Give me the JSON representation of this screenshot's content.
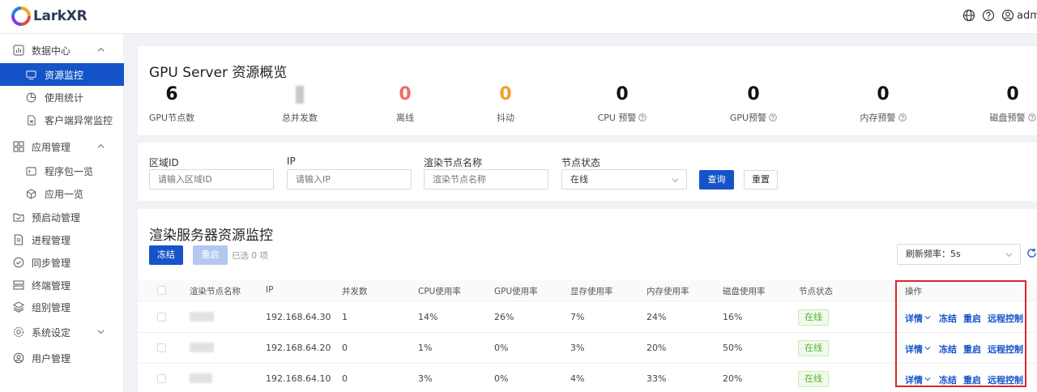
{
  "app": {
    "title": "LarkXR",
    "user": "admin"
  },
  "sidebar": {
    "groups": [
      {
        "label": "数据中心",
        "items": [
          "资源监控",
          "使用统计",
          "客户端异常监控"
        ]
      },
      {
        "label": "应用管理",
        "items": [
          "程序包一览",
          "应用一览"
        ]
      }
    ],
    "singles": [
      "预启动管理",
      "进程管理",
      "同步管理",
      "终端管理",
      "组别管理",
      "系统设定",
      "用户管理"
    ]
  },
  "overview": {
    "title": "GPU Server 资源概览",
    "stats": [
      {
        "value": "6",
        "label": "GPU节点数",
        "color": "#111111"
      },
      {
        "value": "",
        "label": "总并发数",
        "color": "#111111"
      },
      {
        "value": "0",
        "label": "离线",
        "color": "#f06b6b"
      },
      {
        "value": "0",
        "label": "抖动",
        "color": "#f0a030"
      },
      {
        "value": "0",
        "label": "CPU 预警",
        "color": "#111111"
      },
      {
        "value": "0",
        "label": "GPU预警",
        "color": "#111111"
      },
      {
        "value": "0",
        "label": "内存预警",
        "color": "#111111"
      },
      {
        "value": "0",
        "label": "磁盘预警",
        "color": "#111111"
      }
    ]
  },
  "filters": {
    "region": {
      "label": "区域ID",
      "placeholder": "请输入区域ID"
    },
    "ip": {
      "label": "IP",
      "placeholder": "请输入IP"
    },
    "node": {
      "label": "渲染节点名称",
      "placeholder": "渲染节点名称"
    },
    "status": {
      "label": "节点状态",
      "value": "在线"
    },
    "search": "查询",
    "reset": "重置"
  },
  "monitor": {
    "title": "渲染服务器资源监控",
    "freeze": "冻结",
    "restart": "重启",
    "selected": "已选 0 项",
    "refresh": "刷新频率：5s",
    "columns": [
      "渲染节点名称",
      "IP",
      "并发数",
      "CPU使用率",
      "GPU使用率",
      "显存使用率",
      "内存使用率",
      "磁盘使用率",
      "节点状态",
      "操作"
    ],
    "rows": [
      {
        "ip": "192.168.64.30",
        "concurrency": "1",
        "cpu": "14%",
        "gpu": "26%",
        "vram": "7%",
        "mem": "24%",
        "disk": "16%",
        "status": "在线"
      },
      {
        "ip": "192.168.64.20",
        "concurrency": "0",
        "cpu": "1%",
        "gpu": "0%",
        "vram": "3%",
        "mem": "20%",
        "disk": "50%",
        "status": "在线"
      },
      {
        "ip": "192.168.64.10",
        "concurrency": "0",
        "cpu": "3%",
        "gpu": "0%",
        "vram": "4%",
        "mem": "33%",
        "disk": "20%",
        "status": "在线"
      }
    ],
    "actions": {
      "detail": "详情",
      "freeze": "冻结",
      "restart": "重启",
      "remote": "远程控制"
    }
  },
  "colors": {
    "primary": "#1454c8",
    "online": "#52b22e",
    "highlight": "#e02424"
  }
}
